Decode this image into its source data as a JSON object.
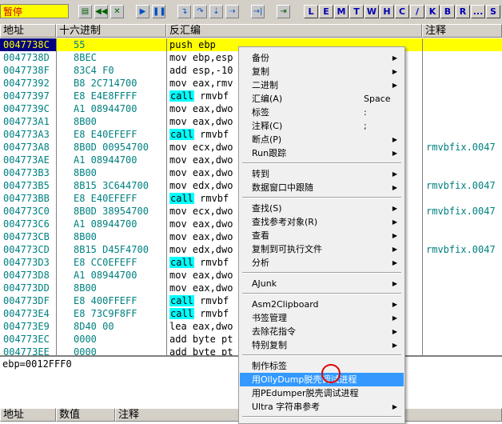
{
  "toolbar": {
    "status": "暂停",
    "letters": [
      "L",
      "E",
      "M",
      "T",
      "W",
      "H",
      "C",
      "/",
      "K",
      "B",
      "R",
      "...",
      "S"
    ]
  },
  "columns": {
    "address": "地址",
    "hex": "十六进制",
    "disasm": "反汇编",
    "comment": "注释"
  },
  "rows": [
    {
      "addr": "0047738C",
      "hex": "55",
      "asm": "push ebp",
      "cmt": ""
    },
    {
      "addr": "0047738D",
      "hex": "8BEC",
      "asm": "mov ebp,esp",
      "cmt": ""
    },
    {
      "addr": "0047738F",
      "hex": "83C4 F0",
      "asm": "add esp,-10",
      "cmt": ""
    },
    {
      "addr": "00477392",
      "hex": "B8 2C714700",
      "asm": "mov eax,rmv",
      "cmt": ""
    },
    {
      "addr": "00477397",
      "hex": "E8 E4E8FFFF",
      "asm": "call",
      "asm2": " rmvbf",
      "cmt": ""
    },
    {
      "addr": "0047739C",
      "hex": "A1 08944700",
      "asm": "mov eax,dwo",
      "cmt": ""
    },
    {
      "addr": "004773A1",
      "hex": "8B00",
      "asm": "mov eax,dwo",
      "cmt": ""
    },
    {
      "addr": "004773A3",
      "hex": "E8 E40EFEFF",
      "asm": "call",
      "asm2": " rmvbf",
      "cmt": ""
    },
    {
      "addr": "004773A8",
      "hex": "8B0D 00954700",
      "asm": "mov ecx,dwo",
      "cmt": "rmvbfix.0047"
    },
    {
      "addr": "004773AE",
      "hex": "A1 08944700",
      "asm": "mov eax,dwo",
      "cmt": ""
    },
    {
      "addr": "004773B3",
      "hex": "8B00",
      "asm": "mov eax,dwo",
      "cmt": ""
    },
    {
      "addr": "004773B5",
      "hex": "8B15 3C644700",
      "asm": "mov edx,dwo",
      "cmt": "rmvbfix.0047"
    },
    {
      "addr": "004773BB",
      "hex": "E8 E40EFEFF",
      "asm": "call",
      "asm2": " rmvbf",
      "cmt": ""
    },
    {
      "addr": "004773C0",
      "hex": "8B0D 38954700",
      "asm": "mov ecx,dwo",
      "cmt": "rmvbfix.0047"
    },
    {
      "addr": "004773C6",
      "hex": "A1 08944700",
      "asm": "mov eax,dwo",
      "cmt": ""
    },
    {
      "addr": "004773CB",
      "hex": "8B00",
      "asm": "mov eax,dwo",
      "cmt": ""
    },
    {
      "addr": "004773CD",
      "hex": "8B15 D45F4700",
      "asm": "mov edx,dwo",
      "cmt": "rmvbfix.0047"
    },
    {
      "addr": "004773D3",
      "hex": "E8 CC0EFEFF",
      "asm": "call",
      "asm2": " rmvbf",
      "cmt": ""
    },
    {
      "addr": "004773D8",
      "hex": "A1 08944700",
      "asm": "mov eax,dwo",
      "cmt": ""
    },
    {
      "addr": "004773DD",
      "hex": "8B00",
      "asm": "mov eax,dwo",
      "cmt": ""
    },
    {
      "addr": "004773DF",
      "hex": "E8 400FFEFF",
      "asm": "call",
      "asm2": " rmvbf",
      "cmt": ""
    },
    {
      "addr": "004773E4",
      "hex": "E8 73C9F8FF",
      "asm": "call",
      "asm2": " rmvbf",
      "cmt": ""
    },
    {
      "addr": "004773E9",
      "hex": "8D40 00",
      "asm": "lea eax,dwo",
      "cmt": ""
    },
    {
      "addr": "004773EC",
      "hex": "0000",
      "asm": "add byte pt",
      "cmt": ""
    },
    {
      "addr": "004773EE",
      "hex": "0000",
      "asm": "add byte pt",
      "cmt": ""
    }
  ],
  "info": "ebp=0012FFF0",
  "bottom_columns": {
    "address": "地址",
    "value": "数值",
    "comment": "注释"
  },
  "menu": [
    {
      "label": "备份",
      "sub": true
    },
    {
      "label": "复制",
      "sub": true
    },
    {
      "label": "二进制",
      "sub": true
    },
    {
      "label": "汇编(A)",
      "shortcut": "Space"
    },
    {
      "label": "标签",
      "shortcut": ":"
    },
    {
      "label": "注释(C)",
      "shortcut": ";"
    },
    {
      "label": "断点(P)",
      "sub": true
    },
    {
      "label": "Run跟踪",
      "sub": true
    },
    {
      "sep": true
    },
    {
      "label": "转到",
      "sub": true
    },
    {
      "label": "数据窗口中跟随",
      "sub": true
    },
    {
      "sep": true
    },
    {
      "label": "查找(S)",
      "sub": true
    },
    {
      "label": "查找参考对象(R)",
      "sub": true
    },
    {
      "label": "查看",
      "sub": true
    },
    {
      "label": "复制到可执行文件",
      "sub": true
    },
    {
      "label": "分析",
      "sub": true
    },
    {
      "sep": true
    },
    {
      "label": "AJunk",
      "sub": true
    },
    {
      "sep": true
    },
    {
      "label": "Asm2Clipboard",
      "sub": true
    },
    {
      "label": "书签管理",
      "sub": true
    },
    {
      "label": "去除花指令",
      "sub": true
    },
    {
      "label": "特别复制",
      "sub": true
    },
    {
      "sep": true
    },
    {
      "label": "制作标签"
    },
    {
      "label": "用OllyDump脱壳调试进程",
      "highlight": true
    },
    {
      "label": "用PEdumper脱壳调试进程"
    },
    {
      "label": "Ultra 字符串参考",
      "sub": true
    },
    {
      "sep": true
    }
  ]
}
